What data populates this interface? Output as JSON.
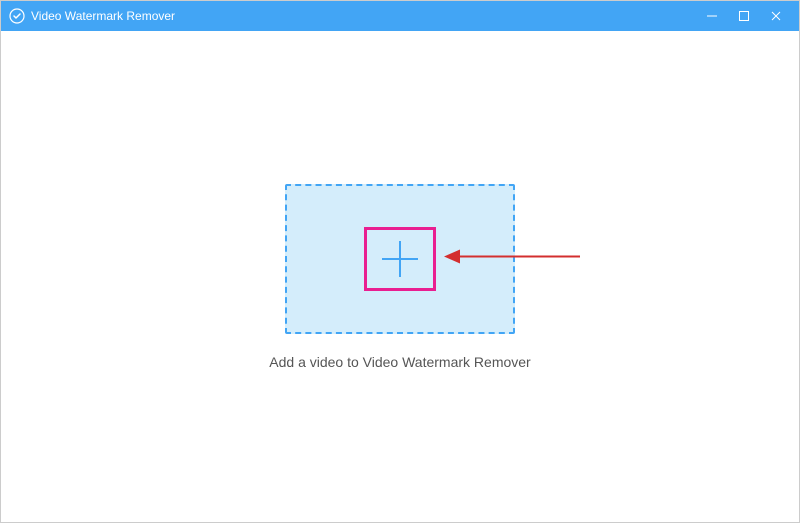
{
  "app": {
    "title": "Video Watermark Remover"
  },
  "main": {
    "instruction": "Add a video to Video Watermark Remover"
  },
  "colors": {
    "accent": "#42a5f5",
    "dropzone_bg": "#d4edfb",
    "highlight": "#e91e90",
    "arrow": "#d32f2f"
  }
}
